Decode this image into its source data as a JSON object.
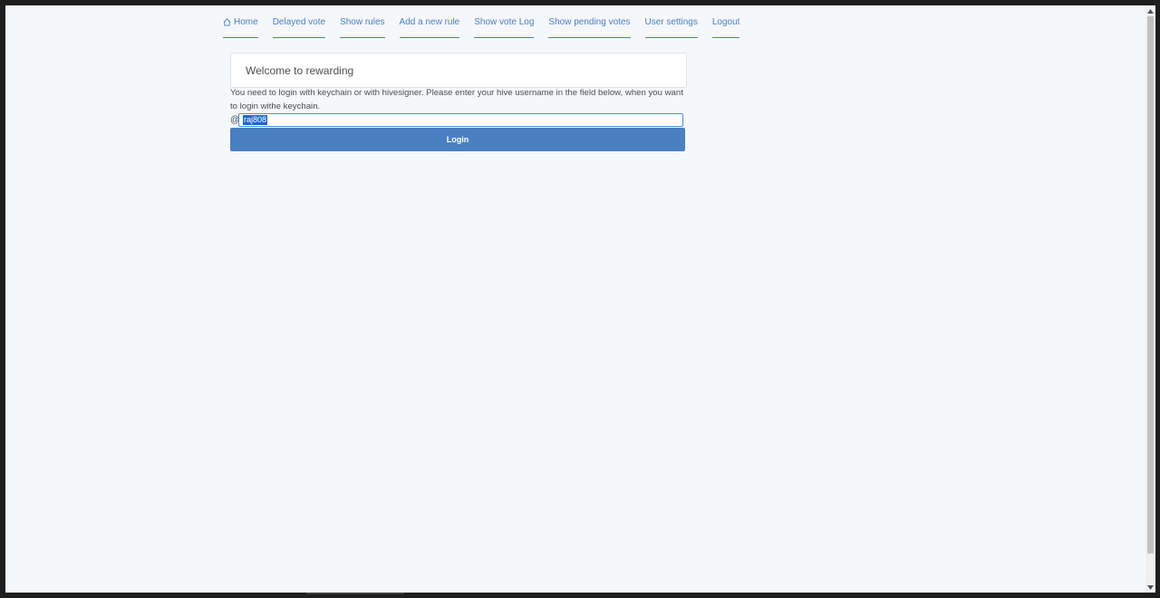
{
  "nav": {
    "items": [
      {
        "label": "Home",
        "icon": "home-icon"
      },
      {
        "label": "Delayed vote"
      },
      {
        "label": "Show rules"
      },
      {
        "label": "Add a new rule"
      },
      {
        "label": "Show vote Log"
      },
      {
        "label": "Show pending votes"
      },
      {
        "label": "User settings"
      },
      {
        "label": "Logout"
      }
    ]
  },
  "card": {
    "title": "Welcome to rewarding"
  },
  "login": {
    "info": "You need to login with keychain or with hivesigner. Please enter your hive username in the field below, when you want to login withe keychain.",
    "at_sign": "@",
    "username_value": "raj808",
    "button_label": "Login"
  },
  "colors": {
    "accent": "#4a7fc1",
    "background": "#f5f7fa",
    "selection": "#2563c9"
  }
}
